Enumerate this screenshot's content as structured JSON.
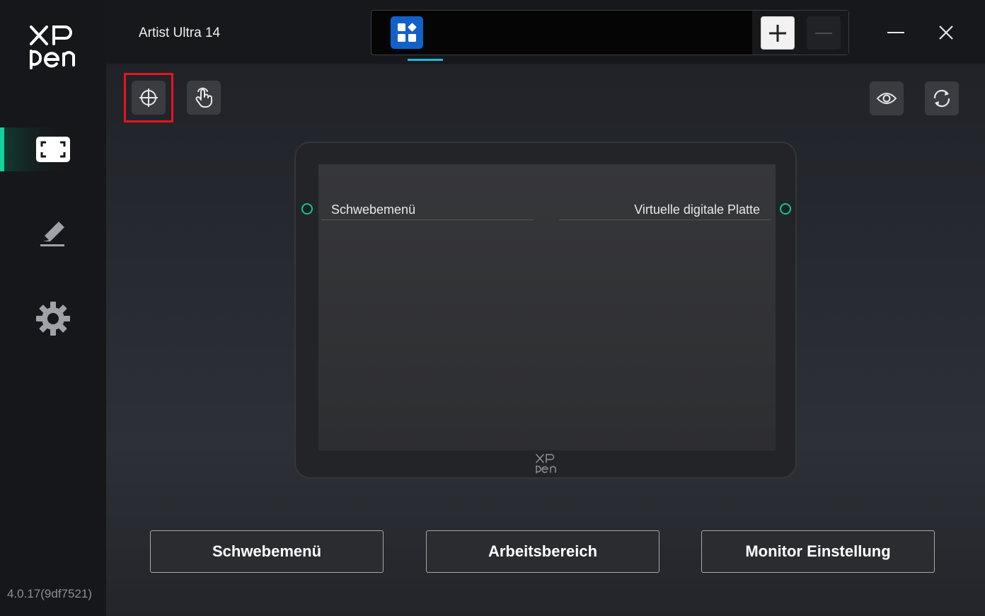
{
  "sidebar": {
    "version": "4.0.17(9df7521)",
    "items": [
      {
        "icon": "display-area-icon"
      },
      {
        "icon": "pen-icon"
      },
      {
        "icon": "gear-icon"
      }
    ]
  },
  "header": {
    "device_name": "Artist Ultra 14",
    "active_tab_icon": "app-grid-icon",
    "add_icon": "plus-icon",
    "remove_icon": "minus-icon"
  },
  "toolbar": {
    "crosshair_icon": "crosshair-icon",
    "touch_icon": "touch-hand-icon",
    "preview_icon": "eye-icon",
    "refresh_icon": "refresh-icon"
  },
  "tablet": {
    "left_key_label": "Schwebemenü",
    "right_key_label": "Virtuelle digitale Platte"
  },
  "buttons": {
    "schwebemenu": "Schwebemenü",
    "arbeitsbereich": "Arbeitsbereich",
    "monitor": "Monitor Einstellung"
  },
  "colors": {
    "accent": "#12d39a",
    "tab_blue": "#1261c9",
    "highlight": "#e8141e"
  }
}
